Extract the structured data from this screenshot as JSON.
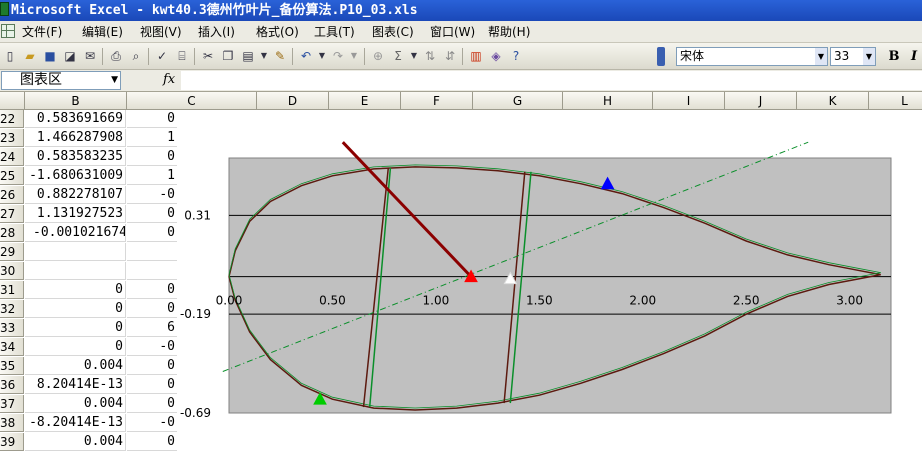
{
  "window": {
    "title": "Microsoft Excel - kwt40.3德州竹叶片_备份算法.P10_03.xls"
  },
  "menu": {
    "items": [
      "文件(F)",
      "编辑(E)",
      "视图(V)",
      "插入(I)",
      "格式(O)",
      "工具(T)",
      "图表(C)",
      "窗口(W)",
      "帮助(H)"
    ]
  },
  "toolbar": {
    "font_name": "宋体",
    "font_size": "33",
    "bold_label": "B",
    "italic_label": "I"
  },
  "formula_bar": {
    "name_box": "图表区",
    "fx_label": "fx"
  },
  "columns": [
    "B",
    "C",
    "D",
    "E",
    "F",
    "G",
    "H",
    "I",
    "J",
    "K",
    "L"
  ],
  "rows": [
    {
      "num": "22",
      "b": "0.583691669",
      "c": "0"
    },
    {
      "num": "23",
      "b": "1.466287908",
      "c": "1"
    },
    {
      "num": "24",
      "b": "0.583583235",
      "c": "0"
    },
    {
      "num": "25",
      "b": "-1.680631009",
      "c": "1"
    },
    {
      "num": "26",
      "b": "0.882278107",
      "c": "-0"
    },
    {
      "num": "27",
      "b": "1.131927523",
      "c": "0"
    },
    {
      "num": "28",
      "b": "-0.001021674",
      "c": "0"
    },
    {
      "num": "29",
      "b": "",
      "c": ""
    },
    {
      "num": "30",
      "b": "",
      "c": ""
    },
    {
      "num": "31",
      "b": "0",
      "c": "0"
    },
    {
      "num": "32",
      "b": "0",
      "c": "0"
    },
    {
      "num": "33",
      "b": "0",
      "c": "6"
    },
    {
      "num": "34",
      "b": "0",
      "c": "-0"
    },
    {
      "num": "35",
      "b": "0.004",
      "c": "0"
    },
    {
      "num": "36",
      "b": "8.20414E-13",
      "c": "0"
    },
    {
      "num": "37",
      "b": "0.004",
      "c": "0"
    },
    {
      "num": "38",
      "b": "-8.20414E-13",
      "c": "-0"
    },
    {
      "num": "39",
      "b": "0.004",
      "c": "0"
    }
  ],
  "chart_data": {
    "type": "scatter",
    "xlim": [
      0,
      3.2
    ],
    "ylim": [
      -0.69,
      0.6
    ],
    "x_ticks": [
      "0.00",
      "0.50",
      "1.00",
      "1.50",
      "2.00",
      "2.50",
      "3.00"
    ],
    "x_tick_values": [
      0,
      0.5,
      1.0,
      1.5,
      2.0,
      2.5,
      3.0
    ],
    "y_ticks": [
      "0.31",
      "-0.19",
      "-0.69"
    ],
    "y_tick_values": [
      0.31,
      -0.19,
      -0.69
    ],
    "grid_y": [
      0.31,
      0.0,
      -0.19
    ],
    "plot_background": "#c0c0c0",
    "series": [
      {
        "color": "#5c1a0f",
        "x": [
          0.0,
          0.03,
          0.1,
          0.2,
          0.35,
          0.5,
          0.7,
          0.9,
          1.1,
          1.3,
          1.5,
          1.7,
          1.9,
          2.1,
          2.3,
          2.5,
          2.7,
          2.9,
          3.05,
          3.15
        ],
        "y": [
          0.0,
          0.13,
          0.28,
          0.38,
          0.46,
          0.51,
          0.545,
          0.555,
          0.55,
          0.535,
          0.51,
          0.47,
          0.42,
          0.35,
          0.27,
          0.18,
          0.11,
          0.06,
          0.03,
          0.01
        ]
      },
      {
        "color": "#5c1a0f",
        "x": [
          0.0,
          0.03,
          0.1,
          0.2,
          0.35,
          0.5,
          0.7,
          0.9,
          1.1,
          1.3,
          1.5,
          1.7,
          1.9,
          2.1,
          2.3,
          2.5,
          2.7,
          2.9,
          3.05,
          3.15
        ],
        "y": [
          0.0,
          -0.12,
          -0.28,
          -0.42,
          -0.55,
          -0.62,
          -0.665,
          -0.675,
          -0.665,
          -0.64,
          -0.6,
          -0.54,
          -0.47,
          -0.39,
          -0.3,
          -0.19,
          -0.1,
          -0.04,
          -0.01,
          0.01
        ]
      },
      {
        "color": "#5c1a0f",
        "x": [
          0.77,
          0.65
        ],
        "y": [
          0.55,
          -0.66
        ]
      },
      {
        "color": "#5c1a0f",
        "x": [
          1.43,
          1.33
        ],
        "y": [
          0.53,
          -0.64
        ]
      },
      {
        "color": "#0a8f2a",
        "x": [
          0.78,
          0.68
        ],
        "y": [
          0.55,
          -0.66
        ]
      },
      {
        "color": "#0a8f2a",
        "x": [
          1.46,
          1.36
        ],
        "y": [
          0.53,
          -0.64
        ]
      },
      {
        "color": "#0a8f2a",
        "style": "dashdot",
        "x": [
          -0.03,
          2.8
        ],
        "y": [
          -0.48,
          0.68
        ]
      },
      {
        "color": "#8b0000",
        "style": "thick",
        "x": [
          0.55,
          1.17
        ],
        "y": [
          0.68,
          0.0
        ]
      }
    ],
    "markers": [
      {
        "color": "#ff0000",
        "x": 1.17,
        "y": 0.0
      },
      {
        "color": "#ffffff",
        "x": 1.36,
        "y": -0.01
      },
      {
        "color": "#0000ff",
        "x": 1.83,
        "y": 0.47
      },
      {
        "color": "#00cc00",
        "x": 0.44,
        "y": -0.62
      }
    ]
  }
}
